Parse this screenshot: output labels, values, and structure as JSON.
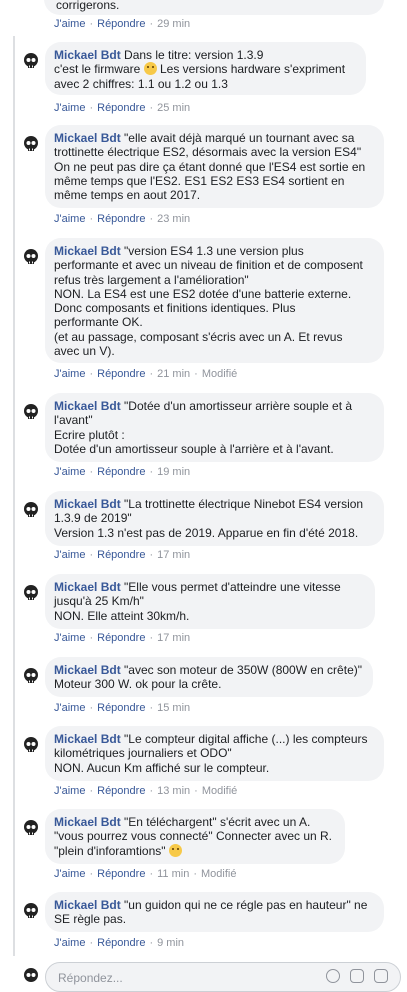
{
  "top_partial": {
    "text": "corrigerons.",
    "like": "J'aime",
    "reply": "Répondre",
    "time": "29 min"
  },
  "comments": [
    {
      "author": "Mickael Bdt",
      "lines": [
        "Dans le titre: version 1.3.9",
        "c'est le firmware",
        "avec 2 chiffres: 1.1 ou 1.2 ou 1.3"
      ],
      "line1_after_emoji": "Les versions hardware s'expriment",
      "like": "J'aime",
      "reply": "Répondre",
      "time": "25 min",
      "modified": ""
    },
    {
      "author": "Mickael Bdt",
      "lines": [
        "\"elle avait déjà marqué un tournant avec sa",
        "trottinette électrique ES2, désormais avec la version ES4\"",
        "On ne peut pas dire ça étant donné que l'ES4 est sortie en",
        "même temps que l'ES2. ES1 ES2 ES3 ES4 sortient en",
        "même temps en aout 2017."
      ],
      "like": "J'aime",
      "reply": "Répondre",
      "time": "23 min",
      "modified": ""
    },
    {
      "author": "Mickael Bdt",
      "lines": [
        "\"version ES4 1.3 une version plus",
        "performante et avec un niveau de finition et de composent",
        "refus très largement a l'amélioration\"",
        "NON. La ES4 est une ES2 dotée d'une batterie externe.",
        "Donc composants et finitions identiques. Plus",
        "performante OK.",
        "(et au passage, composant s'écris avec un A. Et revus",
        "avec un V)."
      ],
      "like": "J'aime",
      "reply": "Répondre",
      "time": "21 min",
      "modified": "Modifié"
    },
    {
      "author": "Mickael Bdt",
      "lines": [
        "\"Dotée d'un amortisseur arrière souple et à",
        "l'avant\"",
        "Ecrire plutôt :",
        "Dotée d'un amortisseur souple à l'arrière et à l'avant."
      ],
      "like": "J'aime",
      "reply": "Répondre",
      "time": "19 min",
      "modified": ""
    },
    {
      "author": "Mickael Bdt",
      "lines": [
        "\"La trottinette électrique Ninebot ES4 version",
        "1.3.9 de 2019\"",
        "Version 1.3 n'est pas de 2019. Apparue en fin d'été 2018."
      ],
      "like": "J'aime",
      "reply": "Répondre",
      "time": "17 min",
      "modified": ""
    },
    {
      "author": "Mickael Bdt",
      "lines": [
        "\"Elle vous permet d'atteindre une vitesse",
        "jusqu'à 25 Km/h\"",
        "NON. Elle atteint 30km/h."
      ],
      "like": "J'aime",
      "reply": "Répondre",
      "time": "17 min",
      "modified": ""
    },
    {
      "author": "Mickael Bdt",
      "lines": [
        "\"avec son moteur de 350W (800W en crête)\"",
        "Moteur 300 W. ok pour la crête."
      ],
      "like": "J'aime",
      "reply": "Répondre",
      "time": "15 min",
      "modified": ""
    },
    {
      "author": "Mickael Bdt",
      "lines": [
        "\"Le compteur digital affiche (...) les compteurs",
        "kilométriques journaliers et ODO\"",
        "NON. Aucun Km affiché sur le compteur."
      ],
      "like": "J'aime",
      "reply": "Répondre",
      "time": "13 min",
      "modified": "Modifié"
    },
    {
      "author": "Mickael Bdt",
      "lines": [
        "\"En téléchargent\" s'écrit avec un A.",
        "\"vous pourrez vous connecté\" Connecter avec un R.",
        "\"plein d'inforamtions\""
      ],
      "like": "J'aime",
      "reply": "Répondre",
      "time": "11 min",
      "modified": "Modifié"
    },
    {
      "author": "Mickael Bdt",
      "lines": [
        "\"un guidon qui ne ce régle pas en hauteur\" ne",
        "SE règle pas."
      ],
      "like": "J'aime",
      "reply": "Répondre",
      "time": "9 min",
      "modified": ""
    }
  ],
  "composer": {
    "placeholder": "Répondez..."
  },
  "colors": {
    "author": "#385898",
    "bubble": "#f2f3f5",
    "meta": "#90949c"
  },
  "icons": {
    "avatar": "skull-avatar-icon",
    "emoji_smile": "smiley-emoji-icon",
    "emoji_laugh": "laughing-emoji-icon",
    "composer_emoji": "emoji-icon",
    "composer_camera": "camera-icon",
    "composer_gif": "gif-icon"
  }
}
